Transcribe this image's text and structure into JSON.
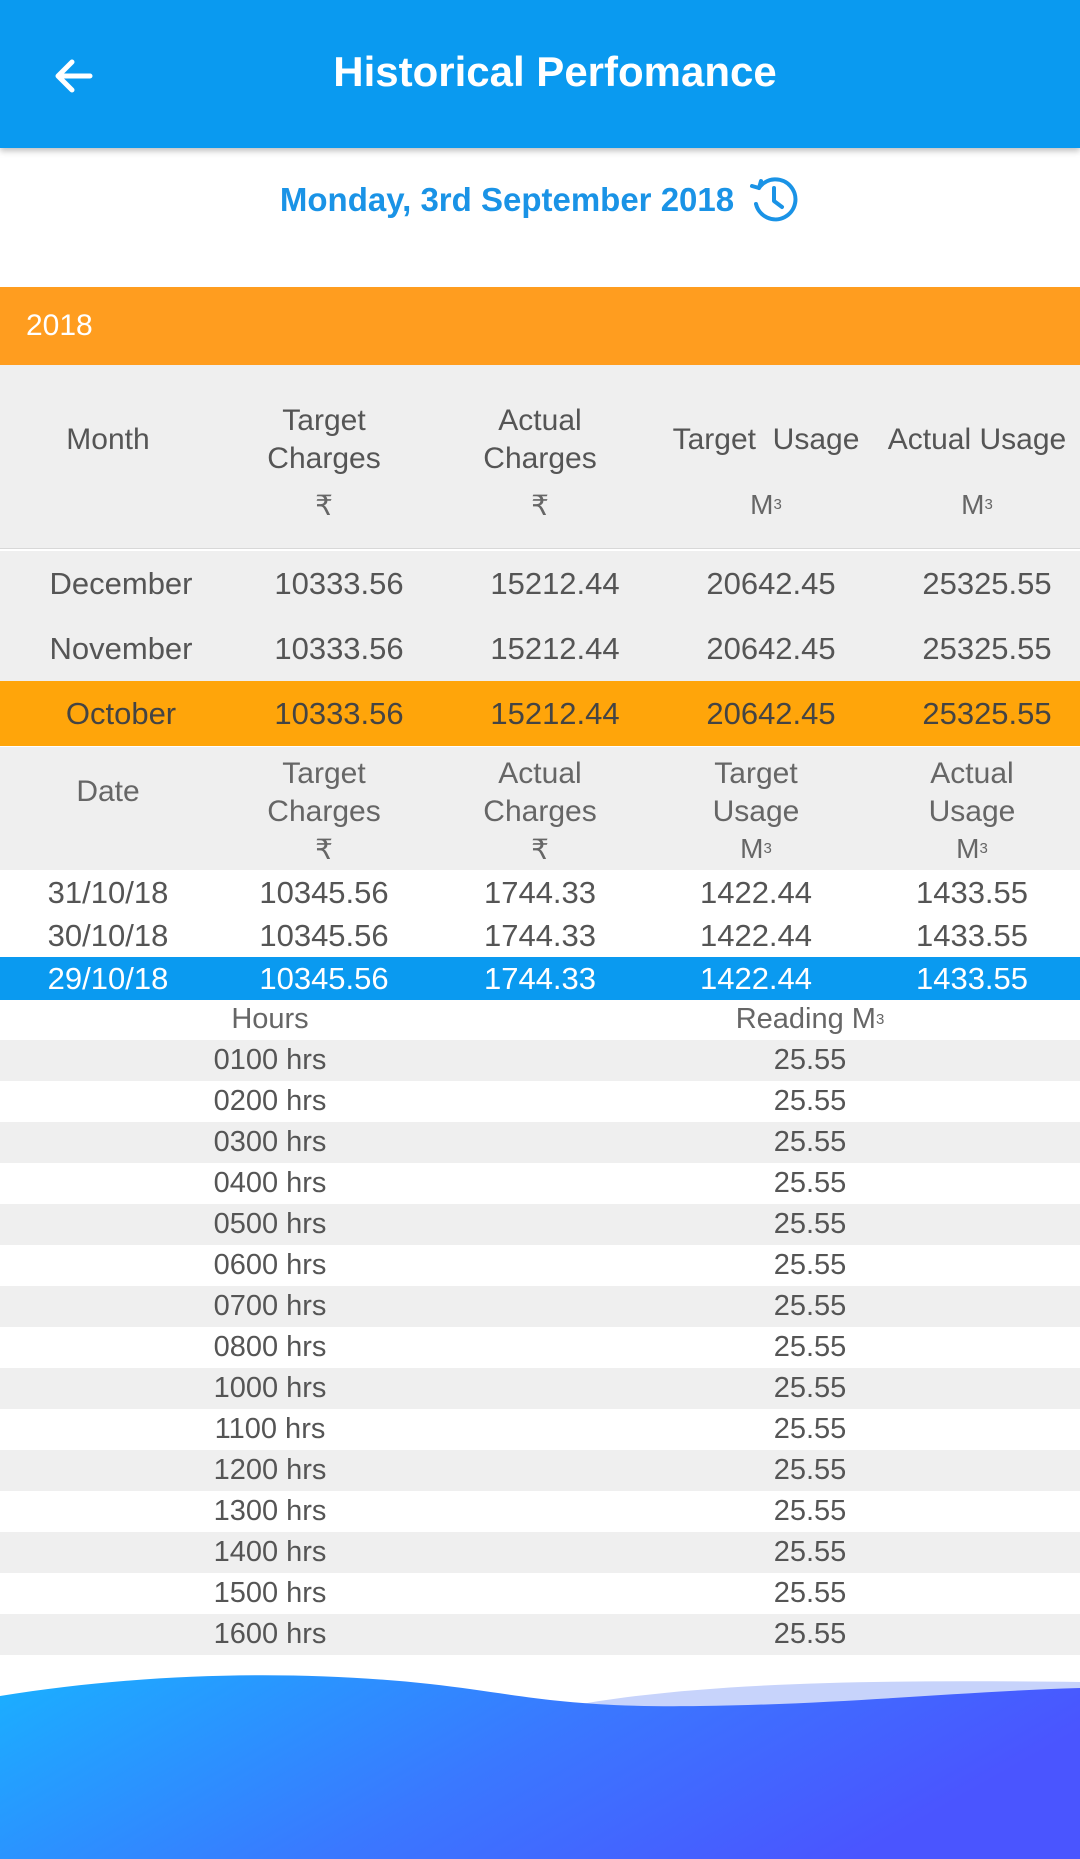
{
  "header": {
    "title": "Historical Perfomance"
  },
  "date_selector": {
    "date": "Monday, 3rd September 2018"
  },
  "year": "2018",
  "monthly": {
    "headers": [
      "Month",
      "Target\nCharges",
      "Actual\nCharges",
      "Target  Usage",
      "Actual Usage"
    ],
    "units": [
      "",
      "₹",
      "₹",
      "M",
      "M"
    ],
    "unit_sup": [
      "",
      "",
      "",
      "3",
      "3"
    ],
    "rows": [
      {
        "month": "December",
        "target_charges": "10333.56",
        "actual_charges": "15212.44",
        "target_usage": "20642.45",
        "actual_usage": "25325.55"
      },
      {
        "month": "November",
        "target_charges": "10333.56",
        "actual_charges": "15212.44",
        "target_usage": "20642.45",
        "actual_usage": "25325.55"
      },
      {
        "month": "October",
        "target_charges": "10333.56",
        "actual_charges": "15212.44",
        "target_usage": "20642.45",
        "actual_usage": "25325.55"
      }
    ],
    "selected_row": "October"
  },
  "daily": {
    "headers": [
      [
        "Date"
      ],
      [
        "Target",
        "Charges"
      ],
      [
        "Actual",
        "Charges"
      ],
      [
        "Target",
        "Usage"
      ],
      [
        "Actual",
        "Usage"
      ]
    ],
    "units": [
      "",
      "₹",
      "₹",
      "M",
      "M"
    ],
    "unit_sup": "3",
    "rows": [
      {
        "date": "31/10/18",
        "target_charges": "10345.56",
        "actual_charges": "1744.33",
        "target_usage": "1422.44",
        "actual_usage": "1433.55"
      },
      {
        "date": "30/10/18",
        "target_charges": "10345.56",
        "actual_charges": "1744.33",
        "target_usage": "1422.44",
        "actual_usage": "1433.55"
      },
      {
        "date": "29/10/18",
        "target_charges": "10345.56",
        "actual_charges": "1744.33",
        "target_usage": "1422.44",
        "actual_usage": "1433.55"
      }
    ],
    "selected_row": "29/10/18"
  },
  "hourly": {
    "header_hours": "Hours",
    "header_reading": "Reading M",
    "header_reading_sup": "3",
    "rows": [
      {
        "hour": "0100 hrs",
        "reading": "25.55"
      },
      {
        "hour": "0200 hrs",
        "reading": "25.55"
      },
      {
        "hour": "0300 hrs",
        "reading": "25.55"
      },
      {
        "hour": "0400 hrs",
        "reading": "25.55"
      },
      {
        "hour": "0500 hrs",
        "reading": "25.55"
      },
      {
        "hour": "0600 hrs",
        "reading": "25.55"
      },
      {
        "hour": "0700 hrs",
        "reading": "25.55"
      },
      {
        "hour": "0800 hrs",
        "reading": "25.55"
      },
      {
        "hour": "1000 hrs",
        "reading": "25.55"
      },
      {
        "hour": "1100 hrs",
        "reading": "25.55"
      },
      {
        "hour": "1200 hrs",
        "reading": "25.55"
      },
      {
        "hour": "1300 hrs",
        "reading": "25.55"
      },
      {
        "hour": "1400 hrs",
        "reading": "25.55"
      },
      {
        "hour": "1500 hrs",
        "reading": "25.55"
      },
      {
        "hour": "1600 hrs",
        "reading": "25.55"
      }
    ]
  },
  "colors": {
    "primary": "#0a9af0",
    "accent": "#ff9d1f",
    "row_grey": "#efefef",
    "date_text": "#1a93e6"
  },
  "icons": {
    "back": "arrow-left-icon",
    "history": "history-clock-icon"
  }
}
